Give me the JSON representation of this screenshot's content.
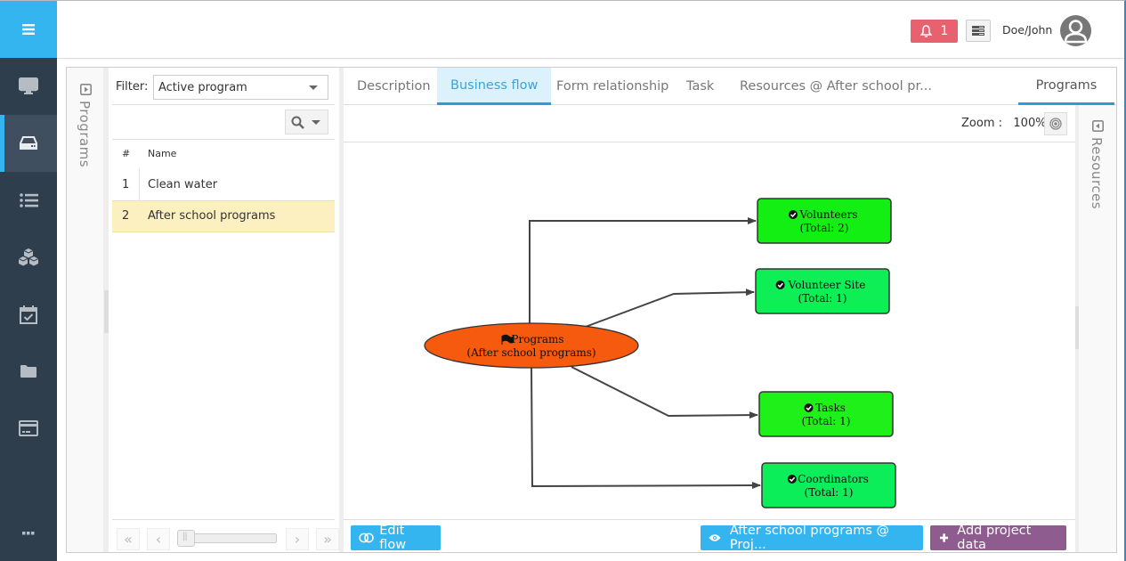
{
  "app": {
    "menu_icon": "hamburger-icon",
    "rail": [
      {
        "id": "desktop",
        "icon": "monitor-icon",
        "active": false
      },
      {
        "id": "drive",
        "icon": "hard-drive-icon",
        "active": true
      },
      {
        "id": "list",
        "icon": "list-icon",
        "active": false
      },
      {
        "id": "cubes",
        "icon": "cubes-icon",
        "active": false
      },
      {
        "id": "calendar",
        "icon": "calendar-check-icon",
        "active": false
      },
      {
        "id": "folder",
        "icon": "folder-icon",
        "active": false
      },
      {
        "id": "card",
        "icon": "credit-card-icon",
        "active": false
      },
      {
        "id": "more",
        "icon": "more-icon",
        "active": false
      }
    ]
  },
  "header": {
    "notification_count": "1",
    "username": "Doe/John"
  },
  "programs_panel": {
    "title": "Programs",
    "filter_label": "Filter:",
    "filter_value": "Active program",
    "columns": [
      "#",
      "Name"
    ],
    "rows": [
      {
        "num": "1",
        "name": "Clean water",
        "selected": false
      },
      {
        "num": "2",
        "name": "After school programs",
        "selected": true
      }
    ],
    "pager": {
      "first": "«",
      "prev": "‹",
      "next": "›",
      "last": "»"
    }
  },
  "tabs": [
    {
      "label": "Description",
      "active": false
    },
    {
      "label": "Business flow",
      "active": true
    },
    {
      "label": "Form relationship",
      "active": false
    },
    {
      "label": "Task",
      "active": false
    },
    {
      "label": "Resources @ After school pr...",
      "active": false
    }
  ],
  "right_tab": {
    "label": "Programs",
    "active": true
  },
  "toolbar": {
    "zoom_label": "Zoom :",
    "zoom_value": "100%"
  },
  "flow": {
    "root": {
      "title": "Programs",
      "subtitle": "(After school programs)",
      "icon": "flag-icon",
      "color": "#f55a0e"
    },
    "nodes": [
      {
        "title": "Volunteers",
        "subtitle": "(Total: 2)",
        "color": "#13ef13"
      },
      {
        "title": "Volunteer Site",
        "subtitle": "(Total: 1)",
        "color": "#0def55"
      },
      {
        "title": "Tasks",
        "subtitle": "(Total: 1)",
        "color": "#1ff01a"
      },
      {
        "title": "Coordinators",
        "subtitle": "(Total: 1)",
        "color": "#0ced5a"
      }
    ]
  },
  "actions": {
    "edit_flow": "Edit flow",
    "view_project": "After school programs @ Proj...",
    "add_project_data": "Add project data"
  },
  "resources_panel": {
    "title": "Resources"
  },
  "colors": {
    "accent": "#35b5f0",
    "rail_bg": "#2f3e4d",
    "notification": "#e8616e",
    "purple": "#8e5c8e",
    "selected_row": "#fdf0c0"
  }
}
